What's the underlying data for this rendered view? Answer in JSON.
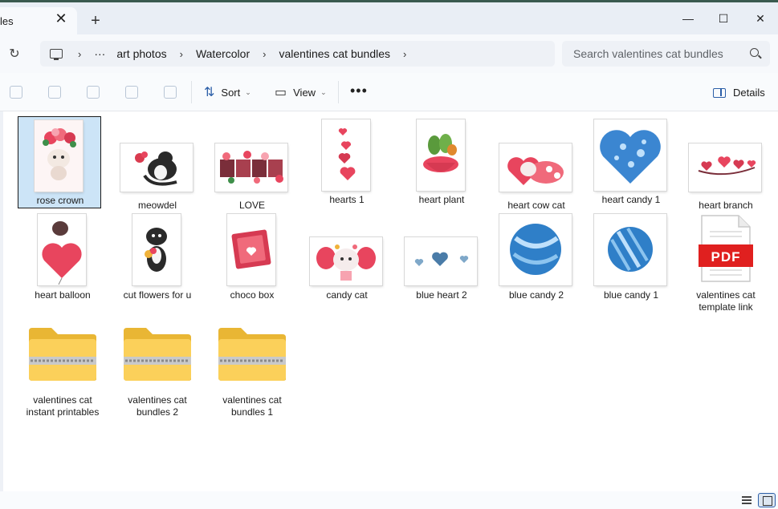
{
  "window": {
    "tab_title": "les",
    "tab_close_glyph": "✕",
    "new_tab_glyph": "+",
    "minimize_glyph": "—",
    "maximize_glyph": "☐",
    "close_glyph": "✕"
  },
  "address": {
    "refresh_glyph": "↻",
    "chevron": "›",
    "overflow": "···",
    "crumbs": [
      "art photos",
      "Watercolor",
      "valentines cat bundles"
    ],
    "search_placeholder": "Search valentines cat bundles"
  },
  "toolbar": {
    "sort_label": "Sort",
    "view_label": "View",
    "more_glyph": "•••",
    "details_label": "Details",
    "dropdown_glyph": "⌄",
    "sort_glyph": "⇅",
    "view_glyph": "▭"
  },
  "files": [
    {
      "name": "rose crown",
      "icon": "image-thumbnail"
    },
    {
      "name": "meowdel",
      "icon": "image-thumbnail"
    },
    {
      "name": "LOVE",
      "icon": "image-thumbnail"
    },
    {
      "name": "hearts 1",
      "icon": "image-thumbnail"
    },
    {
      "name": "heart plant",
      "icon": "image-thumbnail"
    },
    {
      "name": "heart cow cat",
      "icon": "image-thumbnail"
    },
    {
      "name": "heart candy 1",
      "icon": "image-thumbnail"
    },
    {
      "name": "heart branch",
      "icon": "image-thumbnail"
    },
    {
      "name": "heart balloon",
      "icon": "image-thumbnail"
    },
    {
      "name": "cut flowers for u",
      "icon": "image-thumbnail"
    },
    {
      "name": "choco box",
      "icon": "image-thumbnail"
    },
    {
      "name": "candy cat",
      "icon": "image-thumbnail"
    },
    {
      "name": "blue heart 2",
      "icon": "image-thumbnail"
    },
    {
      "name": "blue candy 2",
      "icon": "image-thumbnail"
    },
    {
      "name": "blue candy 1",
      "icon": "image-thumbnail"
    },
    {
      "name": "valentines cat template link",
      "icon": "pdf-icon",
      "badge": "PDF"
    },
    {
      "name": "valentines cat instant printables",
      "icon": "zip-folder-icon"
    },
    {
      "name": "valentines cat bundles 2",
      "icon": "zip-folder-icon"
    },
    {
      "name": "valentines cat bundles 1",
      "icon": "zip-folder-icon"
    }
  ],
  "selected_file": "rose crown"
}
